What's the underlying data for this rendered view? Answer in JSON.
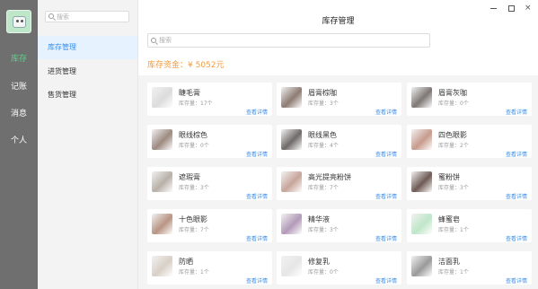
{
  "rail": {
    "items": [
      {
        "label": "库存",
        "active": true
      },
      {
        "label": "记账",
        "active": false
      },
      {
        "label": "消息",
        "active": false
      },
      {
        "label": "个人",
        "active": false
      }
    ]
  },
  "sidebar": {
    "search_placeholder": "搜索",
    "items": [
      {
        "label": "库存管理",
        "active": true
      },
      {
        "label": "进货管理",
        "active": false
      },
      {
        "label": "售货管理",
        "active": false
      }
    ]
  },
  "header": {
    "title": "库存管理",
    "close_glyph": "×"
  },
  "main": {
    "search_placeholder": "搜索",
    "capital_label": "库存资金：",
    "capital_value": "¥ 5052元",
    "accent_color": "#f39c3c",
    "link_color": "#3a8ee6"
  },
  "products": [
    {
      "name": "睫毛膏",
      "stock": "库存量：17个",
      "link": "查看详情",
      "icon": "mascara-photo",
      "color": "#dcdcdc"
    },
    {
      "name": "眉膏棕咖",
      "stock": "库存量：3个",
      "link": "查看详情",
      "icon": "brow-gel-photo",
      "color": "#8d7b72"
    },
    {
      "name": "眉膏灰咖",
      "stock": "库存量：0个",
      "link": "查看详情",
      "icon": "brow-gel-photo",
      "color": "#7e7774"
    },
    {
      "name": "眼线棕色",
      "stock": "库存量：0个",
      "link": "查看详情",
      "icon": "eyeliner-photo",
      "color": "#9c8a80"
    },
    {
      "name": "眼线黑色",
      "stock": "库存量：4个",
      "link": "查看详情",
      "icon": "eyeliner-photo",
      "color": "#6e6a68"
    },
    {
      "name": "四色眼影",
      "stock": "库存量：2个",
      "link": "查看详情",
      "icon": "eyeshadow-photo",
      "color": "#c79b8c"
    },
    {
      "name": "遮瑕膏",
      "stock": "库存量：3个",
      "link": "查看详情",
      "icon": "concealer-photo",
      "color": "#b8b0a8"
    },
    {
      "name": "高光提亮粉饼",
      "stock": "库存量：7个",
      "link": "查看详情",
      "icon": "highlighter-photo",
      "color": "#c7a59a"
    },
    {
      "name": "蜜粉饼",
      "stock": "库存量：3个",
      "link": "查看详情",
      "icon": "powder-photo",
      "color": "#6f5a55"
    },
    {
      "name": "十色眼影",
      "stock": "库存量：7个",
      "link": "查看详情",
      "icon": "palette-photo",
      "color": "#b89483"
    },
    {
      "name": "精华液",
      "stock": "库存量：3个",
      "link": "查看详情",
      "icon": "serum-photo",
      "color": "#b39ab8"
    },
    {
      "name": "蜂蜜皂",
      "stock": "库存量：1个",
      "link": "查看详情",
      "icon": "soap-photo",
      "color": "#bfe6c8"
    },
    {
      "name": "防晒",
      "stock": "库存量：1个",
      "link": "查看详情",
      "icon": "sunscreen-photo",
      "color": "#d8d0c6"
    },
    {
      "name": "修复乳",
      "stock": "库存量：0个",
      "link": "查看详情",
      "icon": "lotion-photo",
      "color": "#e6e6e6"
    },
    {
      "name": "洁面乳",
      "stock": "库存量：1个",
      "link": "查看详情",
      "icon": "cleanser-photo",
      "color": "#9a9a9a"
    }
  ]
}
